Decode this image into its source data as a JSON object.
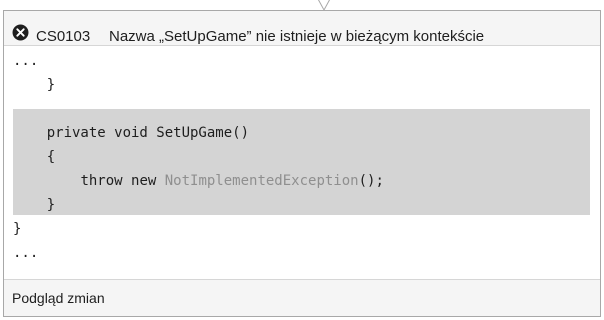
{
  "error": {
    "code": "CS0103",
    "message": "Nazwa „SetUpGame” nie istnieje w bieżącym kontekście",
    "icon": "error-circle-x-icon"
  },
  "code_preview": {
    "lines": [
      {
        "indent": "",
        "text": "..."
      },
      {
        "indent": "    ",
        "text": "}"
      },
      {
        "indent": "",
        "text": ""
      },
      {
        "indent": "    ",
        "text": "private void SetUpGame()"
      },
      {
        "indent": "    ",
        "text": "{"
      },
      {
        "indent": "        ",
        "tokens": [
          "throw new ",
          "NotImplementedException",
          "();"
        ]
      },
      {
        "indent": "    ",
        "text": "}"
      },
      {
        "indent": "",
        "text": "}"
      },
      {
        "indent": "",
        "text": "..."
      }
    ]
  },
  "footer": {
    "label": "Podgląd zmian"
  },
  "colors": {
    "highlight": "#d4d4d4",
    "type_name": "#8f8f8f",
    "error_icon": "#1e1e1e"
  }
}
